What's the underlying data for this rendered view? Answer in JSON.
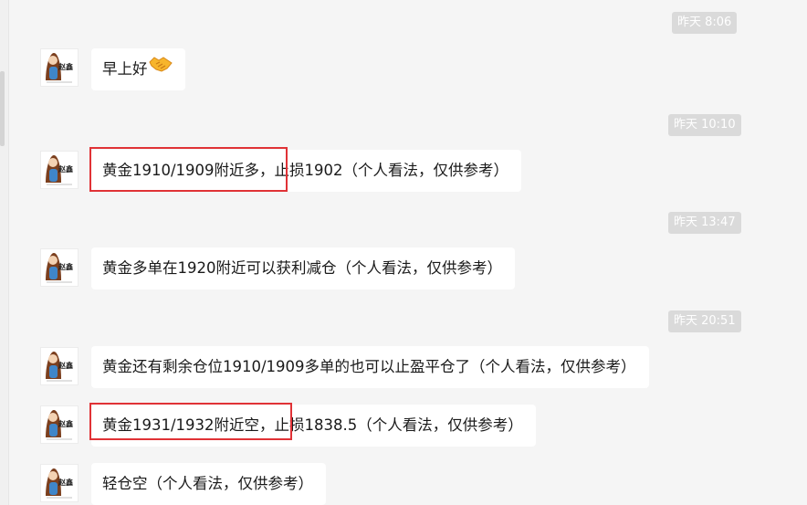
{
  "messages": [
    {
      "timestamp": "昨天 8:06",
      "text": "早上好",
      "emoji": "handshake-emoji"
    },
    {
      "timestamp": "昨天 10:10",
      "text_highlighted": "黄金1910/1909附近多，",
      "text_rest": "止损1902（个人看法，仅供参考）"
    },
    {
      "timestamp": "昨天 13:47",
      "text": "黄金多单在1920附近可以获利减仓（个人看法，仅供参考）"
    },
    {
      "timestamp": "昨天 20:51",
      "text": "黄金还有剩余仓位1910/1909多单的也可以止盈平仓了（个人看法，仅供参考）"
    },
    {
      "text_highlighted": "黄金1931/1932附近空，",
      "text_rest": "止损1838.5（个人看法，仅供参考）"
    },
    {
      "text": "轻仓空（个人看法，仅供参考）"
    }
  ],
  "avatar_label": "赵鑫",
  "colors": {
    "background": "#f5f5f5",
    "bubble": "#ffffff",
    "timestamp_bg": "#dadada",
    "highlight_border": "#e03236"
  }
}
